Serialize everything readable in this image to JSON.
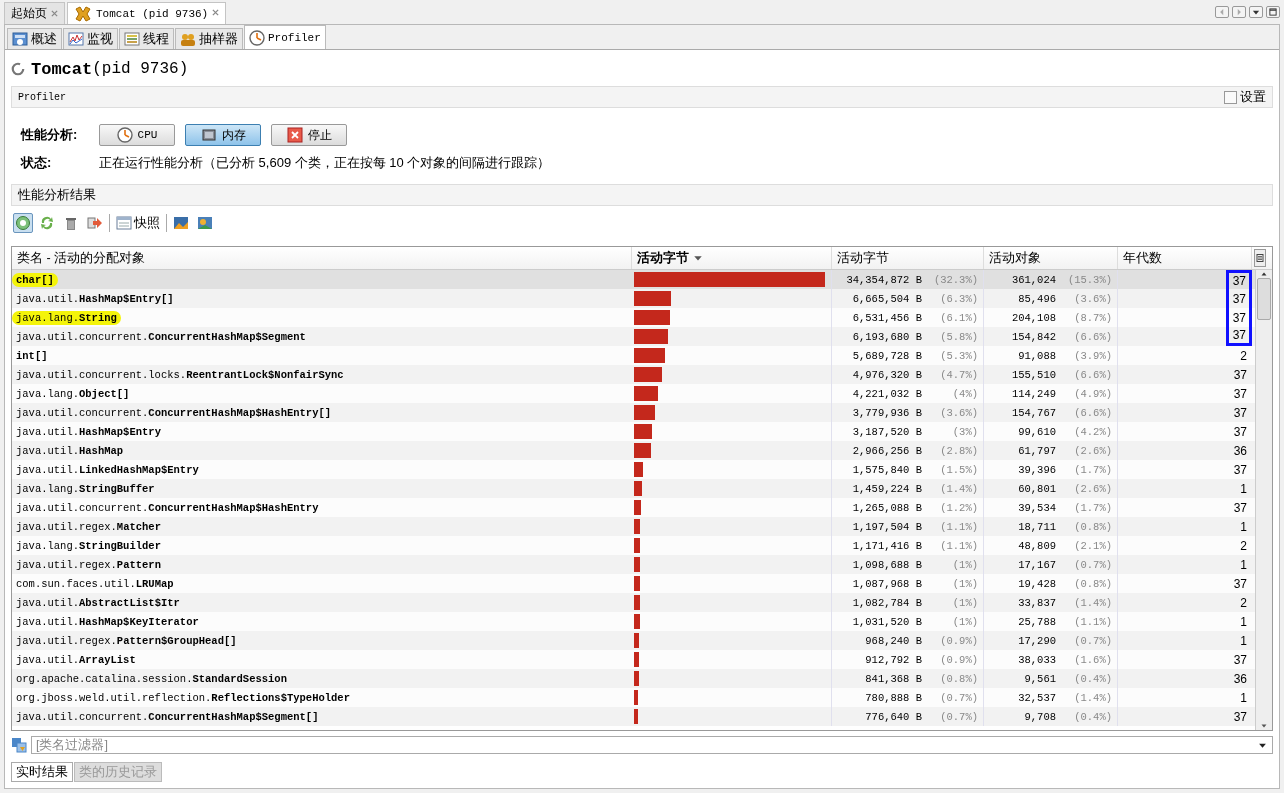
{
  "doc_tabs": [
    {
      "label": "起始页",
      "selected": false
    },
    {
      "label": "Tomcat (pid 9736)",
      "selected": true
    }
  ],
  "view_tabs": [
    {
      "label": "概述",
      "selected": false
    },
    {
      "label": "监视",
      "selected": false
    },
    {
      "label": "线程",
      "selected": false
    },
    {
      "label": "抽样器",
      "selected": false
    },
    {
      "label": "Profiler",
      "selected": true
    }
  ],
  "title": {
    "name": "Tomcat",
    "pid": "(pid 9736)"
  },
  "section": {
    "label": "Profiler",
    "settings": {
      "label": "设置",
      "checked": false
    }
  },
  "profile": {
    "label": "性能分析:",
    "buttons": [
      {
        "label": "CPU",
        "selected": false
      },
      {
        "label": "内存",
        "selected": true
      },
      {
        "label": "停止",
        "selected": false
      }
    ],
    "status_label": "状态:",
    "status": "正在运行性能分析（已分析 5,609 个类，正在按每 10 个对象的间隔进行跟踪）"
  },
  "results": {
    "label": "性能分析结果",
    "toolbar": [
      {
        "kind": "icon",
        "selected": true
      },
      {
        "kind": "icon",
        "selected": false
      },
      {
        "kind": "icon",
        "selected": false
      },
      {
        "kind": "icon",
        "selected": false
      },
      {
        "kind": "sep"
      },
      {
        "kind": "button",
        "label": "快照"
      },
      {
        "kind": "sep"
      },
      {
        "kind": "icon",
        "selected": false
      },
      {
        "kind": "icon",
        "selected": false
      }
    ]
  },
  "table": {
    "columns": [
      {
        "label": "类名 - 活动的分配对象",
        "sorted": false
      },
      {
        "label": "活动字节",
        "sorted": true
      },
      {
        "label": "活动字节",
        "sorted": false
      },
      {
        "label": "活动对象",
        "sorted": false
      },
      {
        "label": "年代数",
        "sorted": false
      }
    ],
    "rows": [
      {
        "name": "**char[]**",
        "level": 0.98,
        "bytes": "34,354,872 B",
        "bytes_pct": "(32.3%)",
        "objects": "361,024",
        "objects_pct": "(15.3%)",
        "generations": "37",
        "selected": true,
        "highlighted": true,
        "boxed": true
      },
      {
        "name": "java.util.**HashMap$Entry[]**",
        "level": 0.19,
        "bytes": "6,665,504 B",
        "bytes_pct": "(6.3%)",
        "objects": "85,496",
        "objects_pct": "(3.6%)",
        "generations": "37",
        "selected": false,
        "highlighted": false,
        "boxed": true
      },
      {
        "name": "java.lang.**String**",
        "level": 0.185,
        "bytes": "6,531,456 B",
        "bytes_pct": "(6.1%)",
        "objects": "204,108",
        "objects_pct": "(8.7%)",
        "generations": "37",
        "selected": false,
        "highlighted": true,
        "boxed": true
      },
      {
        "name": "java.util.concurrent.**ConcurrentHashMap$Segment**",
        "level": 0.176,
        "bytes": "6,193,680 B",
        "bytes_pct": "(5.8%)",
        "objects": "154,842",
        "objects_pct": "(6.6%)",
        "generations": "37",
        "selected": false,
        "highlighted": false,
        "boxed": true
      },
      {
        "name": "**int[]**",
        "level": 0.16,
        "bytes": "5,689,728 B",
        "bytes_pct": "(5.3%)",
        "objects": "91,088",
        "objects_pct": "(3.9%)",
        "generations": "2",
        "selected": false,
        "highlighted": false,
        "boxed": false
      },
      {
        "name": "java.util.concurrent.locks.**ReentrantLock$NonfairSync**",
        "level": 0.142,
        "bytes": "4,976,320 B",
        "bytes_pct": "(4.7%)",
        "objects": "155,510",
        "objects_pct": "(6.6%)",
        "generations": "37",
        "selected": false,
        "highlighted": false,
        "boxed": false
      },
      {
        "name": "java.lang.**Object[]**",
        "level": 0.121,
        "bytes": "4,221,032 B",
        "bytes_pct": "(4%)",
        "objects": "114,249",
        "objects_pct": "(4.9%)",
        "generations": "37",
        "selected": false,
        "highlighted": false,
        "boxed": false
      },
      {
        "name": "java.util.concurrent.**ConcurrentHashMap$HashEntry[]**",
        "level": 0.109,
        "bytes": "3,779,936 B",
        "bytes_pct": "(3.6%)",
        "objects": "154,767",
        "objects_pct": "(6.6%)",
        "generations": "37",
        "selected": false,
        "highlighted": false,
        "boxed": false
      },
      {
        "name": "java.util.**HashMap$Entry**",
        "level": 0.091,
        "bytes": "3,187,520 B",
        "bytes_pct": "(3%)",
        "objects": "99,610",
        "objects_pct": "(4.2%)",
        "generations": "37",
        "selected": false,
        "highlighted": false,
        "boxed": false
      },
      {
        "name": "java.util.**HashMap**",
        "level": 0.085,
        "bytes": "2,966,256 B",
        "bytes_pct": "(2.8%)",
        "objects": "61,797",
        "objects_pct": "(2.6%)",
        "generations": "36",
        "selected": false,
        "highlighted": false,
        "boxed": false
      },
      {
        "name": "java.util.**LinkedHashMap$Entry**",
        "level": 0.045,
        "bytes": "1,575,840 B",
        "bytes_pct": "(1.5%)",
        "objects": "39,396",
        "objects_pct": "(1.7%)",
        "generations": "37",
        "selected": false,
        "highlighted": false,
        "boxed": false
      },
      {
        "name": "java.lang.**StringBuffer**",
        "level": 0.042,
        "bytes": "1,459,224 B",
        "bytes_pct": "(1.4%)",
        "objects": "60,801",
        "objects_pct": "(2.6%)",
        "generations": "1",
        "selected": false,
        "highlighted": false,
        "boxed": false
      },
      {
        "name": "java.util.concurrent.**ConcurrentHashMap$HashEntry**",
        "level": 0.036,
        "bytes": "1,265,088 B",
        "bytes_pct": "(1.2%)",
        "objects": "39,534",
        "objects_pct": "(1.7%)",
        "generations": "37",
        "selected": false,
        "highlighted": false,
        "boxed": false
      },
      {
        "name": "java.util.regex.**Matcher**",
        "level": 0.033,
        "bytes": "1,197,504 B",
        "bytes_pct": "(1.1%)",
        "objects": "18,711",
        "objects_pct": "(0.8%)",
        "generations": "1",
        "selected": false,
        "highlighted": false,
        "boxed": false
      },
      {
        "name": "java.lang.**StringBuilder**",
        "level": 0.033,
        "bytes": "1,171,416 B",
        "bytes_pct": "(1.1%)",
        "objects": "48,809",
        "objects_pct": "(2.1%)",
        "generations": "2",
        "selected": false,
        "highlighted": false,
        "boxed": false
      },
      {
        "name": "java.util.regex.**Pattern**",
        "level": 0.03,
        "bytes": "1,098,688 B",
        "bytes_pct": "(1%)",
        "objects": "17,167",
        "objects_pct": "(0.7%)",
        "generations": "1",
        "selected": false,
        "highlighted": false,
        "boxed": false
      },
      {
        "name": "com.sun.faces.util.**LRUMap**",
        "level": 0.03,
        "bytes": "1,087,968 B",
        "bytes_pct": "(1%)",
        "objects": "19,428",
        "objects_pct": "(0.8%)",
        "generations": "37",
        "selected": false,
        "highlighted": false,
        "boxed": false
      },
      {
        "name": "java.util.**AbstractList$Itr**",
        "level": 0.03,
        "bytes": "1,082,784 B",
        "bytes_pct": "(1%)",
        "objects": "33,837",
        "objects_pct": "(1.4%)",
        "generations": "2",
        "selected": false,
        "highlighted": false,
        "boxed": false
      },
      {
        "name": "java.util.**HashMap$KeyIterator**",
        "level": 0.03,
        "bytes": "1,031,520 B",
        "bytes_pct": "(1%)",
        "objects": "25,788",
        "objects_pct": "(1.1%)",
        "generations": "1",
        "selected": false,
        "highlighted": false,
        "boxed": false
      },
      {
        "name": "java.util.regex.**Pattern$GroupHead[]**",
        "level": 0.027,
        "bytes": "968,240 B",
        "bytes_pct": "(0.9%)",
        "objects": "17,290",
        "objects_pct": "(0.7%)",
        "generations": "1",
        "selected": false,
        "highlighted": false,
        "boxed": false
      },
      {
        "name": "java.util.**ArrayList**",
        "level": 0.027,
        "bytes": "912,792 B",
        "bytes_pct": "(0.9%)",
        "objects": "38,033",
        "objects_pct": "(1.6%)",
        "generations": "37",
        "selected": false,
        "highlighted": false,
        "boxed": false
      },
      {
        "name": "org.apache.catalina.session.**StandardSession**",
        "level": 0.024,
        "bytes": "841,368 B",
        "bytes_pct": "(0.8%)",
        "objects": "9,561",
        "objects_pct": "(0.4%)",
        "generations": "36",
        "selected": false,
        "highlighted": false,
        "boxed": false
      },
      {
        "name": "org.jboss.weld.util.reflection.**Reflections$TypeHolder**",
        "level": 0.021,
        "bytes": "780,888 B",
        "bytes_pct": "(0.7%)",
        "objects": "32,537",
        "objects_pct": "(1.4%)",
        "generations": "1",
        "selected": false,
        "highlighted": false,
        "boxed": false
      },
      {
        "name": "java.util.concurrent.**ConcurrentHashMap$Segment[]**",
        "level": 0.021,
        "bytes": "776,640 B",
        "bytes_pct": "(0.7%)",
        "objects": "9,708",
        "objects_pct": "(0.4%)",
        "generations": "37",
        "selected": false,
        "highlighted": false,
        "boxed": false
      }
    ]
  },
  "filter": {
    "placeholder": "[类名过滤器]"
  },
  "bottom_tabs": [
    {
      "label": "实时结果",
      "selected": true
    },
    {
      "label": "类的历史记录",
      "selected": false
    }
  ]
}
